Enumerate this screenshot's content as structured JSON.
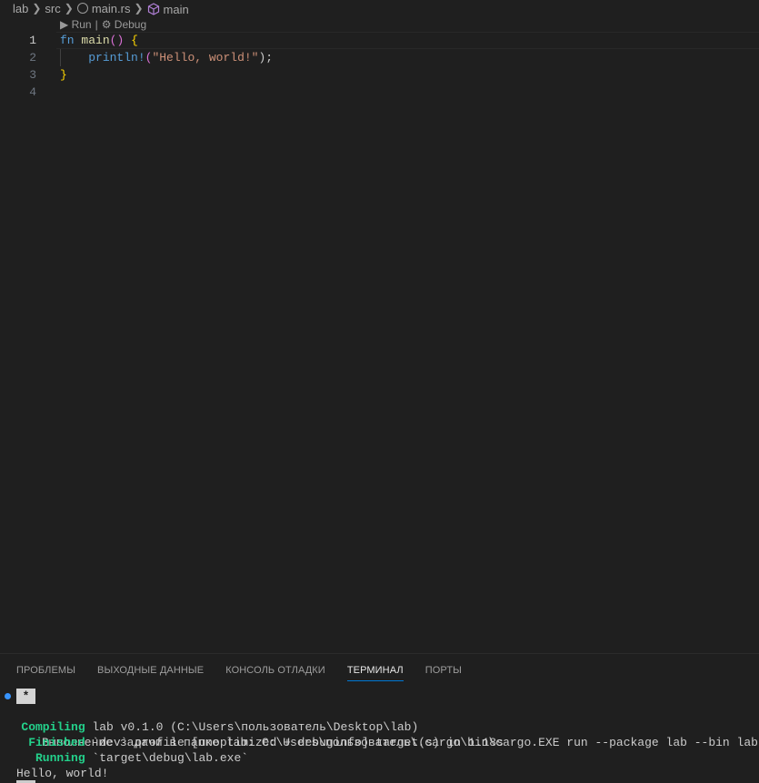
{
  "breadcrumb": {
    "items": [
      "lab",
      "src",
      "main.rs",
      "main"
    ],
    "file_icon": "rust-file-icon",
    "symbol_icon": "symbol-function-icon"
  },
  "codelens": {
    "run": "▶ Run",
    "separator": "|",
    "debug": "⚙ Debug"
  },
  "editor": {
    "lines": [
      {
        "num": "1",
        "tokens": {
          "kw": "fn",
          "name": "main",
          "paren": "()",
          "brace": "{"
        }
      },
      {
        "num": "2",
        "tokens": {
          "macro": "println!",
          "open": "(",
          "str": "\"Hello, world!\"",
          "close": ");"
        }
      },
      {
        "num": "3",
        "tokens": {
          "brace": "}"
        }
      },
      {
        "num": "4"
      }
    ]
  },
  "panel": {
    "tabs": [
      "ПРОБЛЕМЫ",
      "ВЫХОДНЫЕ ДАННЫЕ",
      "КОНСОЛЬ ОТЛАДКИ",
      "ТЕРМИНАЛ",
      "ПОРТЫ"
    ],
    "active_tab": "ТЕРМИНАЛ"
  },
  "terminal": {
    "task_badge": "*",
    "task_text": "Выполнение задачи в папке lab: C:\\Users\\пользователь\\.cargo\\bin\\cargo.EXE run --package lab --bin lab",
    "output": [
      {
        "status": "   Compiling",
        "rest": " lab v0.1.0 (C:\\Users\\пользователь\\Desktop\\lab)"
      },
      {
        "status": "    Finished",
        "rest": " `dev` profile [unoptimized + debuginfo] target(s) in 1.18s"
      },
      {
        "status": "     Running",
        "rest": " `target\\debug\\lab.exe`"
      }
    ],
    "program_output": "Hello, world!"
  },
  "colors": {
    "background": "#1f1f1f",
    "keyword": "#569cd6",
    "function": "#dcdcaa",
    "string": "#ce9178",
    "bracket": "#ffd700",
    "cargo_status": "#23d18b",
    "tab_active_underline": "#0078d4"
  }
}
